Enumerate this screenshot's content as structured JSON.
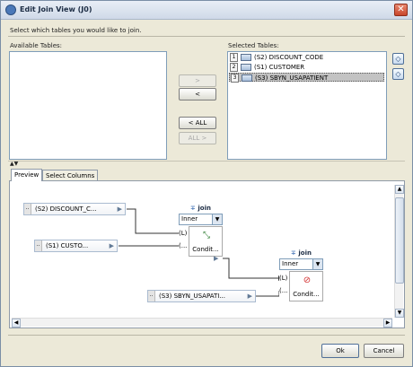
{
  "window": {
    "title": "Edit Join View (J0)",
    "close_glyph": "✕"
  },
  "instruction": "Select which tables you would like to join.",
  "available_tables": {
    "label": "Available Tables:",
    "items": []
  },
  "transfer_buttons": {
    "add": ">",
    "remove": "<",
    "remove_all": "< ALL",
    "add_all": "ALL >"
  },
  "selected_tables": {
    "label": "Selected Tables:",
    "items": [
      {
        "num": "1",
        "text": "(S2) DISCOUNT_CODE"
      },
      {
        "num": "2",
        "text": "(S1) CUSTOMER"
      },
      {
        "num": "3",
        "text": "(S3) SBYN_USAPATIENT"
      }
    ],
    "selected_index": 2
  },
  "order_buttons": {
    "up": "◇",
    "down": "◇"
  },
  "splitter_glyph": "▲▼",
  "tabs": {
    "preview": "Preview",
    "select_columns": "Select Columns",
    "active": "Preview"
  },
  "preview": {
    "sources": [
      {
        "dots": "..",
        "text": "(S2) DISCOUNT_C...",
        "arrow": "▶"
      },
      {
        "dots": "..",
        "text": "(S1) CUSTO...",
        "arrow": "▶"
      },
      {
        "dots": "..",
        "text": "(S3) SBYN_USAPATI...",
        "arrow": "▶"
      }
    ],
    "joins": [
      {
        "title": "join",
        "type": "Inner",
        "left_port": "(L)",
        "right_port": "(...",
        "icon": "⤡",
        "condition": "Condit...",
        "out_arrow": "▶"
      },
      {
        "title": "join",
        "type": "Inner",
        "left_port": "(L)",
        "right_port": "(...",
        "icon": "⊘",
        "condition": "Condit..."
      }
    ],
    "scroll": {
      "up": "▲",
      "down": "▼",
      "left": "◀",
      "right": "▶"
    }
  },
  "footer": {
    "ok": "Ok",
    "cancel": "Cancel"
  },
  "colors": {
    "dialog_bg": "#ece9d8",
    "selection": "#c3c3c3",
    "join_icon_green": "#2e7d32",
    "join_icon_red": "#d32f2f"
  }
}
